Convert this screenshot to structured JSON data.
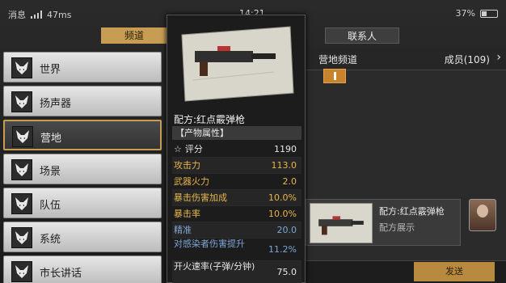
{
  "status": {
    "carrier": "消息",
    "net_speed": "47ms",
    "time": "14:21",
    "battery": "37%"
  },
  "tabs": {
    "active": "频道",
    "contacts": "联系人"
  },
  "channels": [
    {
      "label": "世界",
      "icon": "fox-icon"
    },
    {
      "label": "扬声器",
      "icon": "fox-icon"
    },
    {
      "label": "营地",
      "icon": "fox-icon",
      "selected": true
    },
    {
      "label": "场景",
      "icon": "fox-icon"
    },
    {
      "label": "队伍",
      "icon": "fox-icon"
    },
    {
      "label": "系统",
      "icon": "fox-icon"
    },
    {
      "label": "市长讲话",
      "icon": "fox-icon"
    }
  ],
  "main": {
    "title": "营地频道",
    "members": "成员(109)",
    "message": {
      "title": "配方:红点霰弹枪",
      "subtitle": "配方展示"
    },
    "send_label": "发送"
  },
  "tooltip": {
    "item_name": "配方:红点霰弹枪",
    "section": "【产物属性】",
    "stats": [
      {
        "label": "评分",
        "value": "1190",
        "color": "#e6e6e6",
        "star": true
      },
      {
        "label": "攻击力",
        "value": "113.0",
        "color": "#e7b54a"
      },
      {
        "label": "武器火力",
        "value": "2.0",
        "color": "#e7b54a"
      },
      {
        "label": "暴击伤害加成",
        "value": "10.0%",
        "color": "#e7b54a"
      },
      {
        "label": "暴击率",
        "value": "10.0%",
        "color": "#e7b54a"
      },
      {
        "label": "精准",
        "value": "20.0",
        "color": "#7ea6d6"
      },
      {
        "label": "对感染者伤害提升",
        "value": "11.2%",
        "color": "#7ea6d6"
      },
      {
        "label": "开火速率(子弹/分钟)",
        "value": "75.0",
        "color": "#e6e6e6"
      }
    ]
  }
}
